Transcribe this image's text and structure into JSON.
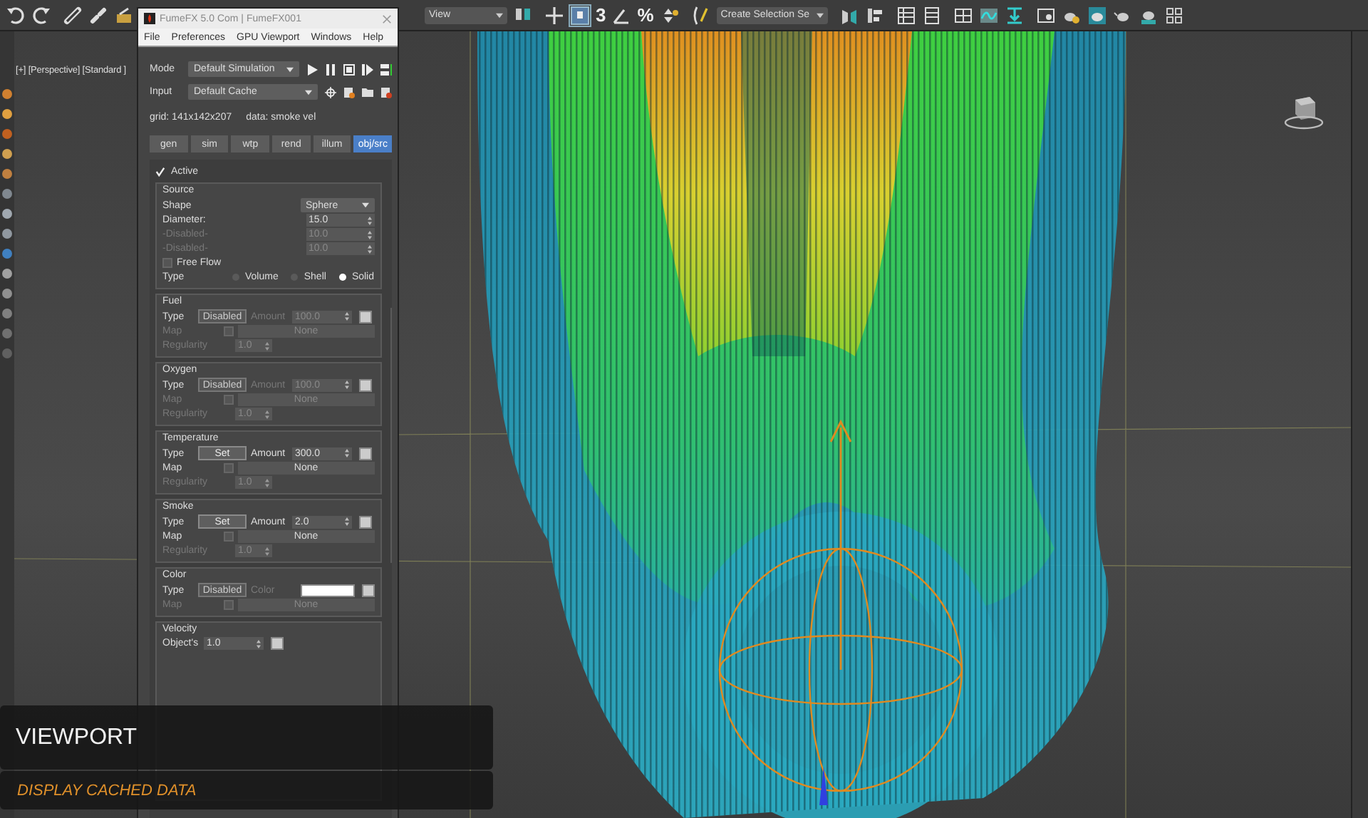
{
  "toolbar": {
    "view_dropdown": "View",
    "snap_glyphs": [
      "3",
      "%"
    ],
    "selection_dropdown": "Create Selection Se"
  },
  "viewport": {
    "label": "[+] [Perspective] [Standard ]"
  },
  "fumefx": {
    "title": "FumeFX 5.0 Com | FumeFX001",
    "menu": [
      "File",
      "Preferences",
      "GPU Viewport",
      "Windows",
      "Help"
    ],
    "mode": {
      "label": "Mode",
      "value": "Default Simulation"
    },
    "input": {
      "label": "Input",
      "value": "Default Cache"
    },
    "grid_info": "grid: 141x142x207",
    "data_info": "data: smoke vel",
    "tabs": [
      {
        "label": "gen",
        "selected": false
      },
      {
        "label": "sim",
        "selected": false
      },
      {
        "label": "wtp",
        "selected": false
      },
      {
        "label": "rend",
        "selected": false
      },
      {
        "label": "illum",
        "selected": false
      },
      {
        "label": "obj/src",
        "selected": true
      }
    ],
    "active": {
      "label": "Active",
      "checked": true
    },
    "source": {
      "title": "Source",
      "shape_label": "Shape",
      "shape": "Sphere",
      "params": [
        {
          "label": "Diameter:",
          "value": "15.0",
          "disabled": false
        },
        {
          "label": "-Disabled-",
          "value": "10.0",
          "disabled": true
        },
        {
          "label": "-Disabled-",
          "value": "10.0",
          "disabled": true
        }
      ],
      "free_flow": {
        "label": "Free Flow",
        "checked": false
      },
      "type_label": "Type",
      "type_options": [
        {
          "label": "Volume",
          "selected": false
        },
        {
          "label": "Shell",
          "selected": false
        },
        {
          "label": "Solid",
          "selected": true
        }
      ]
    },
    "channels": [
      {
        "title": "Fuel",
        "type_label": "Type",
        "type_button": "Disabled",
        "enabled": false,
        "amount_label": "Amount",
        "amount": "100.0",
        "map_label": "Map",
        "map_checked": false,
        "map": "None",
        "regularity_label": "Regularity",
        "regularity": "1.0"
      },
      {
        "title": "Oxygen",
        "type_label": "Type",
        "type_button": "Disabled",
        "enabled": false,
        "amount_label": "Amount",
        "amount": "100.0",
        "map_label": "Map",
        "map_checked": false,
        "map": "None",
        "regularity_label": "Regularity",
        "regularity": "1.0"
      },
      {
        "title": "Temperature",
        "type_label": "Type",
        "type_button": "Set",
        "enabled": true,
        "amount_label": "Amount",
        "amount": "300.0",
        "map_label": "Map",
        "map_checked": false,
        "map": "None",
        "regularity_label": "Regularity",
        "regularity": "1.0"
      },
      {
        "title": "Smoke",
        "type_label": "Type",
        "type_button": "Set",
        "enabled": true,
        "amount_label": "Amount",
        "amount": "2.0",
        "map_label": "Map",
        "map_checked": false,
        "map": "None",
        "regularity_label": "Regularity",
        "regularity": "1.0"
      }
    ],
    "color": {
      "title": "Color",
      "type_label": "Type",
      "type_button": "Disabled",
      "color_label": "Color",
      "color": "#ffffff",
      "map_label": "Map",
      "map_checked": false,
      "map": "None"
    },
    "velocity": {
      "title": "Velocity",
      "objects_label": "Object's",
      "objects_value": "1.0"
    }
  },
  "captions": {
    "title": "VIEWPORT",
    "subtitle": "DISPLAY CACHED DATA"
  }
}
